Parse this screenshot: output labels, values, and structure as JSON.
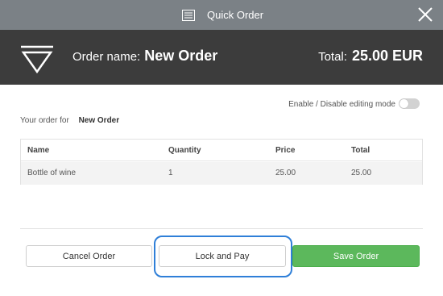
{
  "window": {
    "title": "Quick Order",
    "title_icon": "list-icon",
    "close_icon": "close-icon"
  },
  "header": {
    "logo_icon": "triangle-logo-icon",
    "order_name_label": "Order name:",
    "order_name": "New Order",
    "total_label": "Total:",
    "total_value": "25.00 EUR"
  },
  "edit_toggle": {
    "label": "Enable / Disable editing mode",
    "enabled": false
  },
  "order_for": {
    "label": "Your order for",
    "name": "New Order"
  },
  "table": {
    "columns": [
      "Name",
      "Quantity",
      "Price",
      "Total"
    ],
    "rows": [
      [
        "Bottle of wine",
        "1",
        "25.00",
        "25.00"
      ]
    ]
  },
  "buttons": {
    "cancel": "Cancel Order",
    "lock": "Lock and Pay",
    "save": "Save Order"
  },
  "colors": {
    "titlebar": "#7b8186",
    "header": "#3c3c3c",
    "save_button": "#5cb85c",
    "highlight": "#2f7fd8"
  }
}
